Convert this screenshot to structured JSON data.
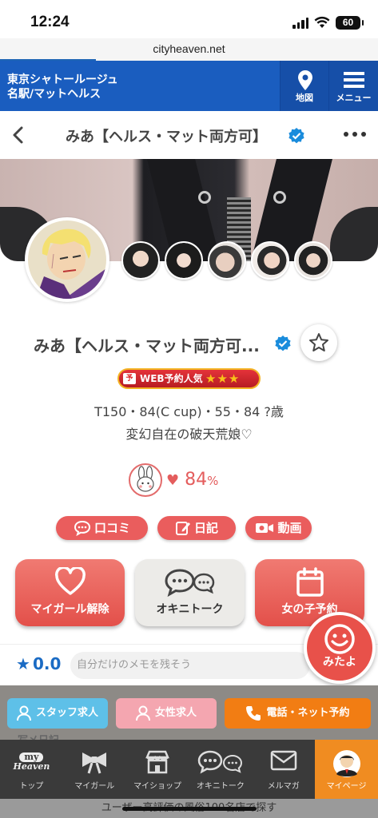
{
  "status": {
    "time": "12:24",
    "battery": "60"
  },
  "browser": {
    "url": "cityheaven.net"
  },
  "header": {
    "shop_line1": "東京シャトールージュ",
    "shop_line2": "名駅/マットヘルス",
    "map_label": "地図",
    "menu_label": "メニュー",
    "brand_color": "#1a5dbf"
  },
  "titlebar": {
    "title": "みあ【ヘルス・マット両方可】"
  },
  "profile": {
    "name": "みあ【ヘルス・マット両方可...",
    "web_badge": "WEB予約人気",
    "web_badge_icon": "予",
    "web_stars": "★★★",
    "specs": "T150・84(C cup)・55・84  ?歳",
    "catchphrase": "変幻自在の破天荒娘♡",
    "match_value": "84",
    "match_unit": "%",
    "heart": "♥"
  },
  "pills": {
    "kuchikomi": "口コミ",
    "diary": "日記",
    "video": "動画"
  },
  "actions": {
    "my_girl": "マイガール解除",
    "okini_talk": "オキニトーク",
    "reserve": "女の子予約"
  },
  "rating": {
    "star": "★",
    "score": "0.0",
    "memo_placeholder": "自分だけのメモを残そう"
  },
  "mitayo": {
    "label": "みたよ"
  },
  "footer_buttons": {
    "staff": "スタッフ求人",
    "female": "女性求人",
    "tel": "電話・ネット予約",
    "behind_text": "写メ日記"
  },
  "tabs": [
    {
      "label": "トップ",
      "logo_top": "my",
      "logo_bottom": "Heaven"
    },
    {
      "label": "マイガール"
    },
    {
      "label": "マイショップ"
    },
    {
      "label": "オキニトーク"
    },
    {
      "label": "メルマガ"
    },
    {
      "label": "マイページ"
    }
  ],
  "bottom_text": "ユーザー高評価の風俗100名店で探す",
  "colors": {
    "accent_red": "#ea5d5d",
    "orange": "#f27d13",
    "verified_blue": "#1a8cdc"
  }
}
